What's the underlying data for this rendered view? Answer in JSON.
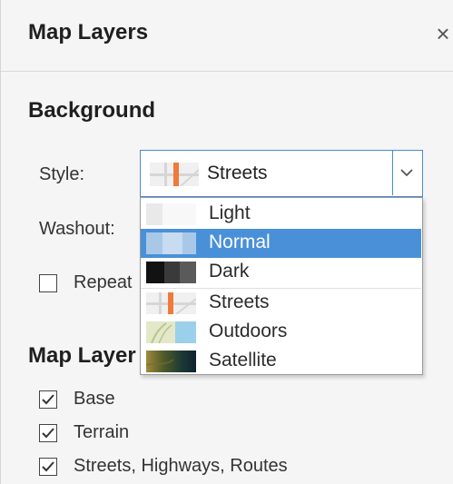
{
  "panel": {
    "title": "Map Layers",
    "close_icon": "close-icon"
  },
  "background": {
    "section_title": "Background",
    "style_label": "Style:",
    "style_value": "Streets",
    "washout_label": "Washout:",
    "repeat_label": "Repeat",
    "repeat_checked": false
  },
  "dropdown": {
    "options": [
      {
        "label": "Light",
        "selected": false,
        "swatch": "light"
      },
      {
        "label": "Normal",
        "selected": true,
        "swatch": "normal"
      },
      {
        "label": "Dark",
        "selected": false,
        "swatch": "dark"
      },
      {
        "label": "Streets",
        "selected": false,
        "swatch": "streets"
      },
      {
        "label": "Outdoors",
        "selected": false,
        "swatch": "outdoors"
      },
      {
        "label": "Satellite",
        "selected": false,
        "swatch": "satellite"
      }
    ]
  },
  "map_layers": {
    "section_title": "Map Layer",
    "items": [
      {
        "label": "Base",
        "checked": true
      },
      {
        "label": "Terrain",
        "checked": true
      },
      {
        "label": "Streets, Highways, Routes",
        "checked": true
      }
    ]
  },
  "colors": {
    "accent": "#4a90d9",
    "select_border": "#4a8ad0",
    "panel_bg": "#f5f5f5"
  }
}
